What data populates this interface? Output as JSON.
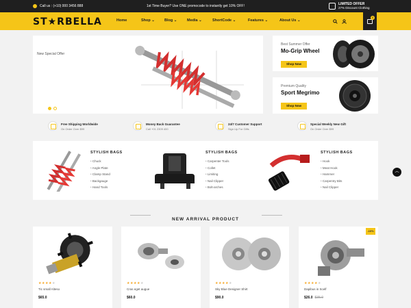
{
  "topbar": {
    "call": "Call us : (+10) 000 3456 888",
    "promo": "1st Time Buyer? Use ONE promocode to instantly get 10% OFF!",
    "offer_title": "LIMITED OFFER",
    "offer_sub": "27% Discount Clothing"
  },
  "header": {
    "logo": "ST★RBELLA",
    "nav": [
      "Home",
      "Shop ⌄",
      "Blog ⌄",
      "Media ⌄",
      "ShortCode ⌄",
      "Features ⌄",
      "About Us ⌄"
    ],
    "cart_count": "0"
  },
  "hero": {
    "subtitle": "New Special Offer"
  },
  "side_banners": [
    {
      "small": "Best Summer Offer",
      "big": "Mo-Grip Wheel",
      "button": "Shop Now"
    },
    {
      "small": "Premium Quality",
      "big": "Sport Megrimo",
      "button": "Shop Now"
    }
  ],
  "features": [
    {
      "title": "Free Shipping Worldwide",
      "sub": "On Order Over $99"
    },
    {
      "title": "Money Back Guarantee",
      "sub": "Call +01 2309 400"
    },
    {
      "title": "24/7 Customer Support",
      "sub": "Sign Up For Gifts"
    },
    {
      "title": "Special Weekly New Gift",
      "sub": "On Order Over $99"
    }
  ],
  "categories": [
    {
      "title": "STYLISH BAGS",
      "items": [
        "Chuck",
        "Angle Plate",
        "Clamp Stand",
        "Backgauge",
        "Hand Tools"
      ]
    },
    {
      "title": "STYLISH BAGS",
      "items": [
        "Carpenter Tools",
        "Collet",
        "Limiting",
        "Nail Clipper",
        "Bolt-arches"
      ]
    },
    {
      "title": "STYLISH BAGS",
      "items": [
        "Hook",
        "Meat Hook",
        "Hammer",
        "Carpentry Bits",
        "Nail Clipper"
      ]
    }
  ],
  "new_arrival": {
    "heading": "NEW ARRIVAL PRODUCT"
  },
  "products": [
    {
      "name": "Tic small Alteso",
      "price": "$65.0",
      "old": "",
      "stars": 4
    },
    {
      "name": "Cras eget augue",
      "price": "$60.0",
      "old": "",
      "stars": 4
    },
    {
      "name": "Sky Blue Designer Shirt",
      "price": "$90.0",
      "old": "",
      "stars": 4
    },
    {
      "name": "Dapibus in Scelf",
      "price": "$26.0",
      "old": "$35.0",
      "stars": 4,
      "badge": "-10%"
    }
  ],
  "colors": {
    "accent": "#f5c518",
    "dark": "#1f1f1f"
  }
}
